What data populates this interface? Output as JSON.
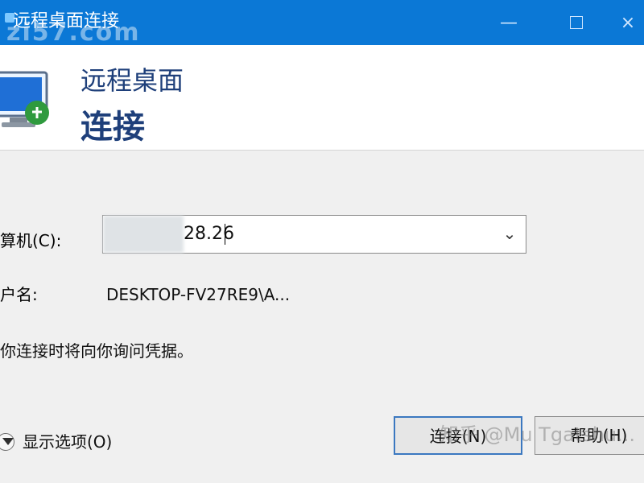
{
  "window": {
    "title": "远程桌面连接",
    "watermark_top": "zi57.com"
  },
  "header": {
    "title1": "远程桌面",
    "title2": "连接"
  },
  "form": {
    "computer_label": "算机(C):",
    "computer_value": "28.26",
    "username_label": "户名:",
    "username_value": "DESKTOP-FV27RE9\\A...",
    "note": "你连接时将向你询问凭据。",
    "options_label": "显示选项(O)"
  },
  "buttons": {
    "connect": "连接(N)",
    "help": "帮助(H)"
  },
  "watermark_bottom": "知乎 @Mu Tgatshu..."
}
